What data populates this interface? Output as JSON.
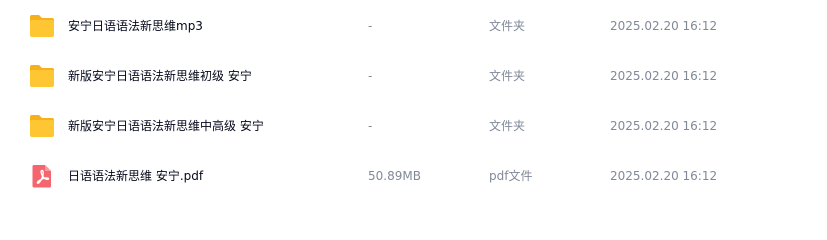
{
  "files": [
    {
      "name": "安宁日语语法新思维mp3",
      "size": "-",
      "type": "文件夹",
      "modified": "2025.02.20 16:12",
      "icon": "folder-icon"
    },
    {
      "name": "新版安宁日语语法新思维初级 安宁",
      "size": "-",
      "type": "文件夹",
      "modified": "2025.02.20 16:12",
      "icon": "folder-icon"
    },
    {
      "name": "新版安宁日语语法新思维中高级 安宁",
      "size": "-",
      "type": "文件夹",
      "modified": "2025.02.20 16:12",
      "icon": "folder-icon"
    },
    {
      "name": "日语语法新思维 安宁.pdf",
      "size": "50.89MB",
      "type": "pdf文件",
      "modified": "2025.02.20 16:12",
      "icon": "pdf-file-icon"
    }
  ],
  "colors": {
    "folder": "#ffc634",
    "folder_back": "#f5b01c",
    "pdf": "#f4656d",
    "name_text": "#03081a",
    "meta_text": "#818999"
  }
}
